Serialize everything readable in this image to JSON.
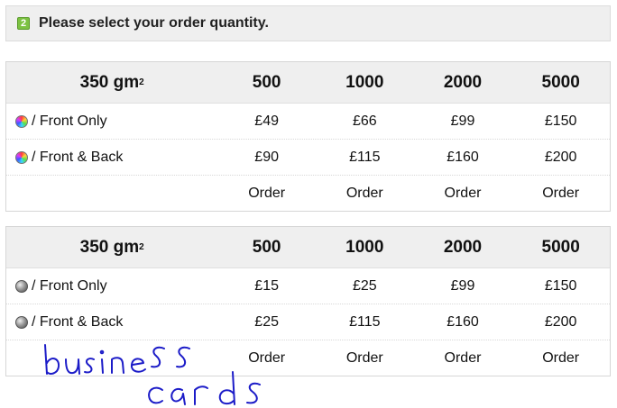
{
  "step": {
    "number": "2",
    "text": "Please select your order quantity."
  },
  "tables": [
    {
      "header": {
        "stock_label": "350 gm",
        "stock_sup": "2",
        "quantities": [
          "500",
          "1000",
          "2000",
          "5000"
        ]
      },
      "rows": [
        {
          "icon": "color-wheel-icon",
          "label": "/ Front Only",
          "prices": [
            "£49",
            "£66",
            "£99",
            "£150"
          ]
        },
        {
          "icon": "color-wheel-icon",
          "label": "/ Front & Back",
          "prices": [
            "£90",
            "£115",
            "£160",
            "£200"
          ]
        }
      ],
      "order_label": "Order"
    },
    {
      "header": {
        "stock_label": "350 gm",
        "stock_sup": "2",
        "quantities": [
          "500",
          "1000",
          "2000",
          "5000"
        ]
      },
      "rows": [
        {
          "icon": "grayscale-ball-icon",
          "label": "/ Front Only",
          "prices": [
            "£15",
            "£25",
            "£99",
            "£150"
          ]
        },
        {
          "icon": "grayscale-ball-icon",
          "label": "/ Front & Back",
          "prices": [
            "£25",
            "£115",
            "£160",
            "£200"
          ]
        }
      ],
      "order_label": "Order"
    }
  ],
  "annotation": {
    "line1": "business",
    "line2": "cards",
    "ink_color": "#1c1cc8"
  }
}
